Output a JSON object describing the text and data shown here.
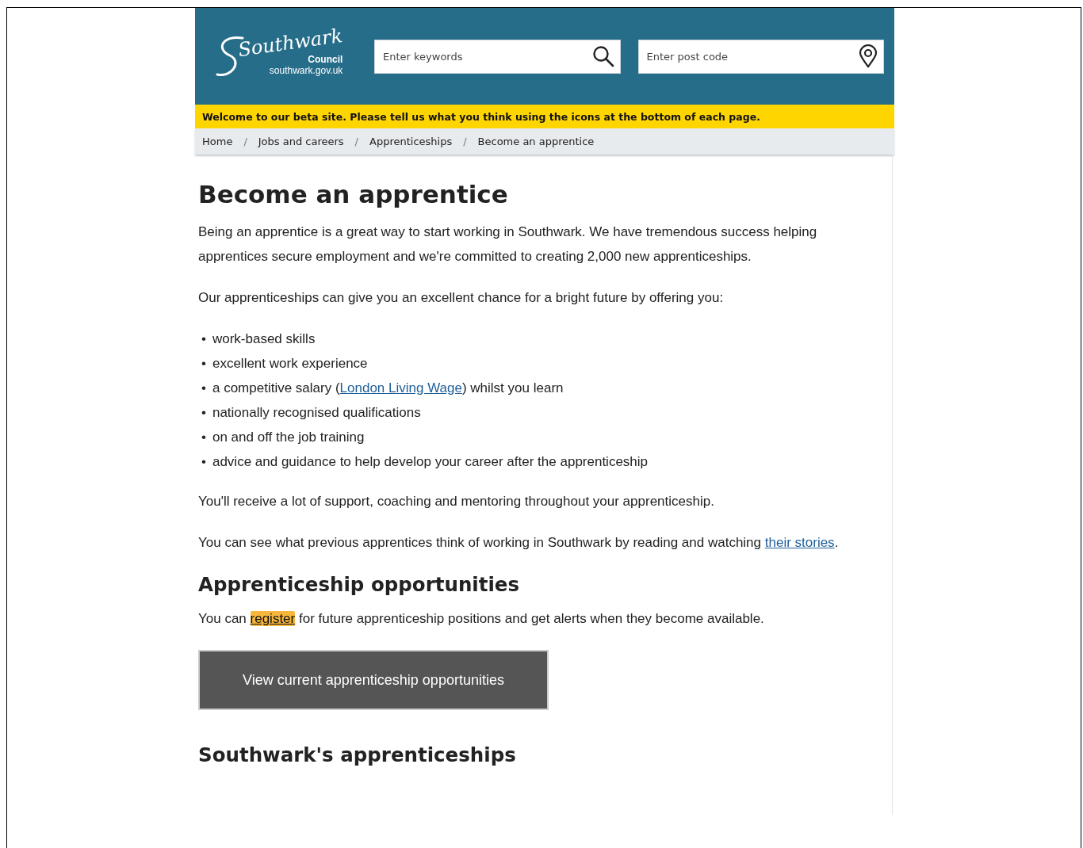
{
  "header": {
    "logo": {
      "script": "Southwark",
      "council": "Council",
      "domain": "southwark.gov.uk"
    },
    "keyword_search": {
      "placeholder": "Enter keywords"
    },
    "postcode_search": {
      "placeholder": "Enter post code"
    }
  },
  "beta_banner": "Welcome to our beta site. Please tell us what you think using the icons at the bottom of each page.",
  "breadcrumb": [
    "Home",
    "Jobs and careers",
    "Apprenticeships",
    "Become an apprentice"
  ],
  "breadcrumb_separator": "/",
  "content": [
    {
      "kind": "h1",
      "text": "Become an apprentice"
    },
    {
      "kind": "paragraph",
      "parts": [
        {
          "kind": "text",
          "text": "Being an apprentice is a great way to start working in Southwark. We have tremendous success helping apprentices secure employment and we're committed to creating 2,000 new apprenticeships."
        }
      ]
    },
    {
      "kind": "paragraph",
      "parts": [
        {
          "kind": "text",
          "text": "Our apprenticeships can give you an excellent chance for a bright future by offering you:"
        }
      ]
    },
    {
      "kind": "list",
      "bullet": "•",
      "items": [
        [
          {
            "kind": "text",
            "text": "work-based skills"
          }
        ],
        [
          {
            "kind": "text",
            "text": "excellent work experience"
          }
        ],
        [
          {
            "kind": "text",
            "text": "a competitive salary ("
          },
          {
            "kind": "link",
            "text": "London Living Wage",
            "focused": false
          },
          {
            "kind": "text",
            "text": ") whilst you learn"
          }
        ],
        [
          {
            "kind": "text",
            "text": "nationally recognised qualifications"
          }
        ],
        [
          {
            "kind": "text",
            "text": "on and off the job training"
          }
        ],
        [
          {
            "kind": "text",
            "text": "advice and guidance to help develop your career after the apprenticeship"
          }
        ]
      ]
    },
    {
      "kind": "paragraph",
      "parts": [
        {
          "kind": "text",
          "text": "You'll receive a lot of support, coaching and mentoring throughout your apprenticeship."
        }
      ]
    },
    {
      "kind": "paragraph",
      "parts": [
        {
          "kind": "text",
          "text": "You can see what previous apprentices think of working in Southwark by reading and watching "
        },
        {
          "kind": "link",
          "text": "their stories",
          "focused": false
        },
        {
          "kind": "text",
          "text": "."
        }
      ]
    },
    {
      "kind": "h2",
      "text": "Apprenticeship opportunities"
    },
    {
      "kind": "paragraph",
      "parts": [
        {
          "kind": "text",
          "text": "You can "
        },
        {
          "kind": "link",
          "text": "register",
          "focused": true
        },
        {
          "kind": "text",
          "text": " for future apprenticeship positions and get alerts when they become available."
        }
      ]
    },
    {
      "kind": "button",
      "text": "View current apprenticeship opportunities"
    },
    {
      "kind": "h2",
      "text": "Southwark's apprenticeships"
    }
  ]
}
